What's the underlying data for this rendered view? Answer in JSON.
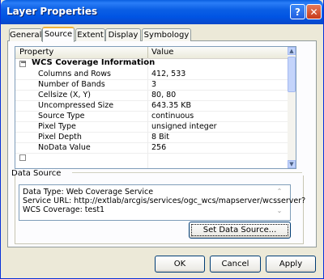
{
  "window": {
    "title": "Layer Properties"
  },
  "titlebar": {
    "help_glyph": "?",
    "close_glyph": "✕"
  },
  "tabs": [
    "General",
    "Source",
    "Extent",
    "Display",
    "Symbology"
  ],
  "active_tab": "Source",
  "grid": {
    "columns": [
      "Property",
      "Value"
    ],
    "category": "WCS Coverage Information",
    "collapse_glyph": "−",
    "rows": [
      {
        "property": "Columns and Rows",
        "value": "412, 533"
      },
      {
        "property": "Number of Bands",
        "value": "3"
      },
      {
        "property": "Cellsize (X, Y)",
        "value": "80, 80"
      },
      {
        "property": "Uncompressed Size",
        "value": "643.35 KB"
      },
      {
        "property": "Source Type",
        "value": "continuous"
      },
      {
        "property": "Pixel Type",
        "value": "unsigned integer"
      },
      {
        "property": "Pixel Depth",
        "value": "8 Bit"
      },
      {
        "property": "NoData Value",
        "value": "256"
      }
    ]
  },
  "data_source": {
    "label": "Data Source",
    "lines": [
      "Data Type: Web Coverage Service",
      "Service URL: http://extlab/arcgis/services/ogc_wcs/mapserver/wcsserver?",
      "WCS Coverage: test1"
    ],
    "set_button": "Set Data Source..."
  },
  "buttons": {
    "ok": "OK",
    "cancel": "Cancel",
    "apply": "Apply"
  },
  "colors": {
    "titlebar": "#0054e3",
    "dialog_bg": "#ece9d8",
    "close_button": "#c73a1a"
  }
}
